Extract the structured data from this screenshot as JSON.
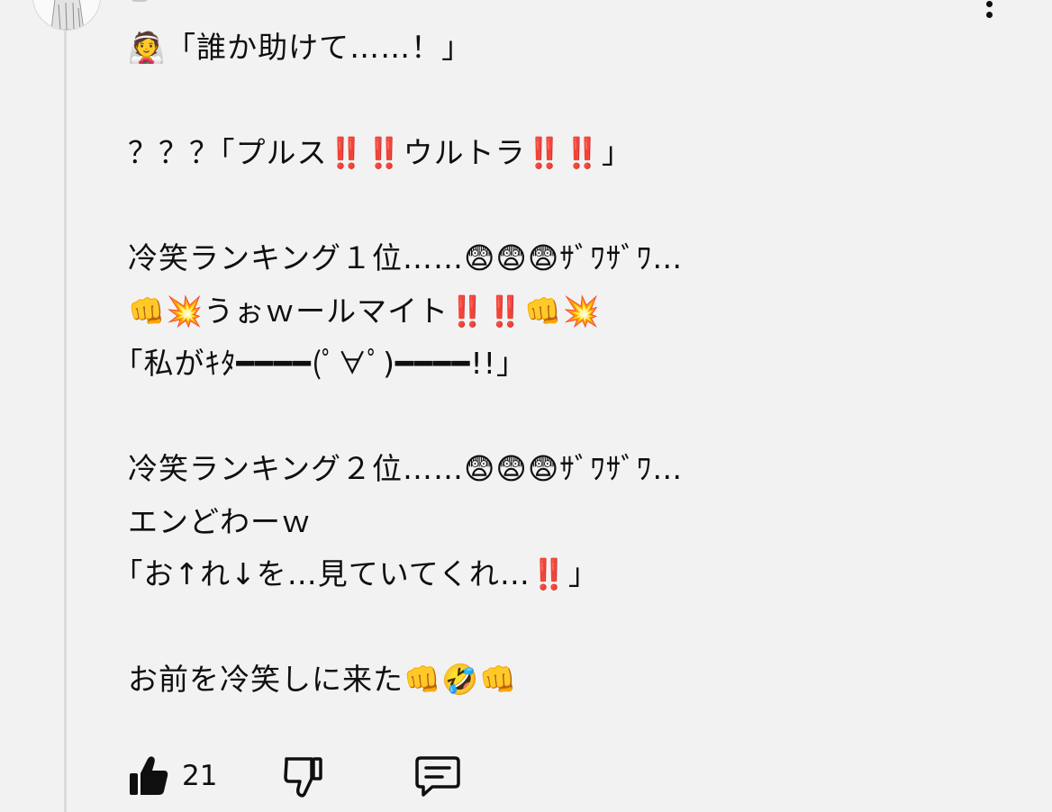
{
  "comment": {
    "lines": [
      "👰「誰か助けて……！」",
      "",
      "？？？｢プルス‼️‼️ウルトラ‼️‼️」",
      "",
      "冷笑ランキング１位……😨😨😨ｻﾞﾜｻﾞﾜ…",
      "👊💥うぉｗールマイト‼️‼️👊💥",
      "｢私がｷﾀ━━━━(ﾟ∀ﾟ)━━━━!!」",
      "",
      "冷笑ランキング２位……😨😨😨ｻﾞﾜｻﾞﾜ…",
      "エンどわーｗ",
      "｢お↑れ↓を…見ていてくれ…‼️」",
      "",
      "お前を冷笑しに来た👊🤣👊"
    ]
  },
  "actions": {
    "like_icon": "thumbs-up-icon",
    "like_count": "21",
    "dislike_icon": "thumbs-down-icon",
    "reply_icon": "reply-comment-icon"
  }
}
